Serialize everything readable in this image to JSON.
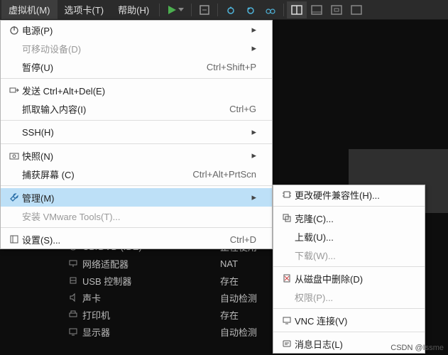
{
  "menubar": {
    "vm": "虚拟机(M)",
    "tabs": "选项卡(T)",
    "help": "帮助(H)"
  },
  "dd1": {
    "power": "电源(P)",
    "removable": "可移动设备(D)",
    "pause": "暂停(U)",
    "pause_accel": "Ctrl+Shift+P",
    "send_cad": "发送 Ctrl+Alt+Del(E)",
    "grab": "抓取输入内容(I)",
    "grab_accel": "Ctrl+G",
    "ssh": "SSH(H)",
    "snapshot": "快照(N)",
    "capture": "捕获屏幕 (C)",
    "capture_accel": "Ctrl+Alt+PrtScn",
    "manage": "管理(M)",
    "install_tools": "安装 VMware Tools(T)...",
    "settings": "设置(S)...",
    "settings_accel": "Ctrl+D"
  },
  "dd2": {
    "hw_compat": "更改硬件兼容性(H)...",
    "clone": "克隆(C)...",
    "upload": "上载(U)...",
    "download": "下载(W)...",
    "delete_disk": "从磁盘中删除(D)",
    "perms": "权限(P)...",
    "vnc": "VNC 连接(V)",
    "msglog": "消息日志(L)"
  },
  "bg": {
    "cddvd": "CD/DVD (IDE)",
    "cddvd_v": "正在使用",
    "net": "网络适配器",
    "net_v": "NAT",
    "usb": "USB 控制器",
    "usb_v": "存在",
    "sound": "声卡",
    "sound_v": "自动检测",
    "printer": "打印机",
    "printer_v": "存在",
    "display": "显示器",
    "display_v": "自动检测"
  },
  "watermark": "CSDN @Issme"
}
